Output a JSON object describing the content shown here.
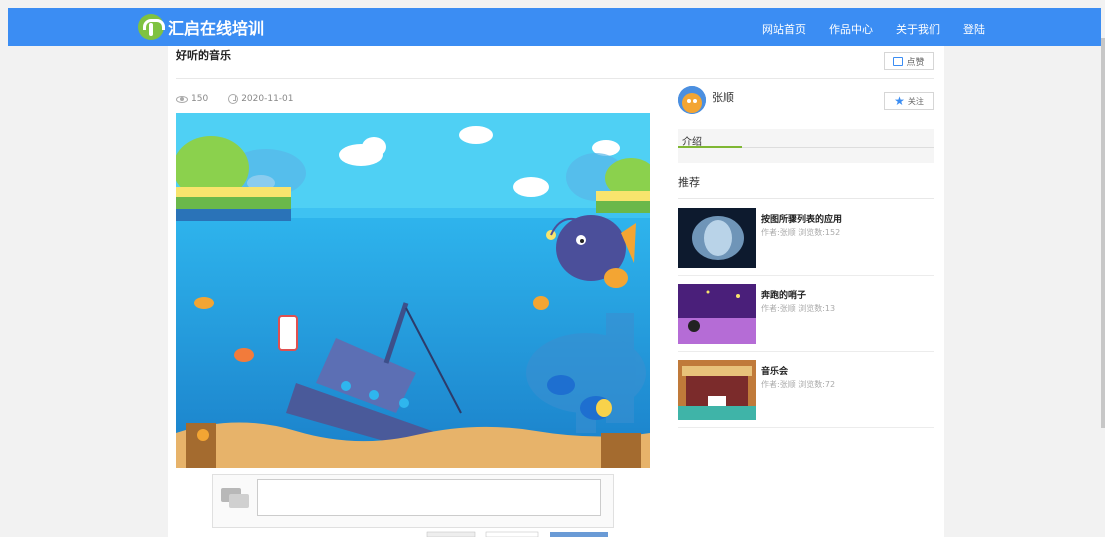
{
  "header": {
    "logo_text": "汇启在线培训",
    "nav": [
      "网站首页",
      "作品中心",
      "关于我们",
      "登陆"
    ]
  },
  "work": {
    "title": "好听的音乐",
    "like_label": "点赞",
    "views": "150",
    "date": "2020-11-01"
  },
  "author": {
    "name": "张顺",
    "follow_label": "关注"
  },
  "intro": {
    "tab_label": "介绍"
  },
  "recommend": {
    "title": "推荐",
    "items": [
      {
        "name": "按图所骤列表的应用",
        "meta": "作者:张顺  浏览数:152"
      },
      {
        "name": "奔跑的哨子",
        "meta": "作者:张顺  浏览数:13"
      },
      {
        "name": "音乐会",
        "meta": "作者:张顺  浏览数:72"
      }
    ]
  },
  "colors": {
    "header": "#3b8df3",
    "sky": "#4fc9f2",
    "sea": "#1e9fe0",
    "sand": "#e7b36a",
    "accent_green": "#7fb733"
  },
  "icons": [
    "logo-tree-icon",
    "thumbs-up-icon",
    "eye-icon",
    "clock-icon",
    "star-icon",
    "comment-icon"
  ]
}
